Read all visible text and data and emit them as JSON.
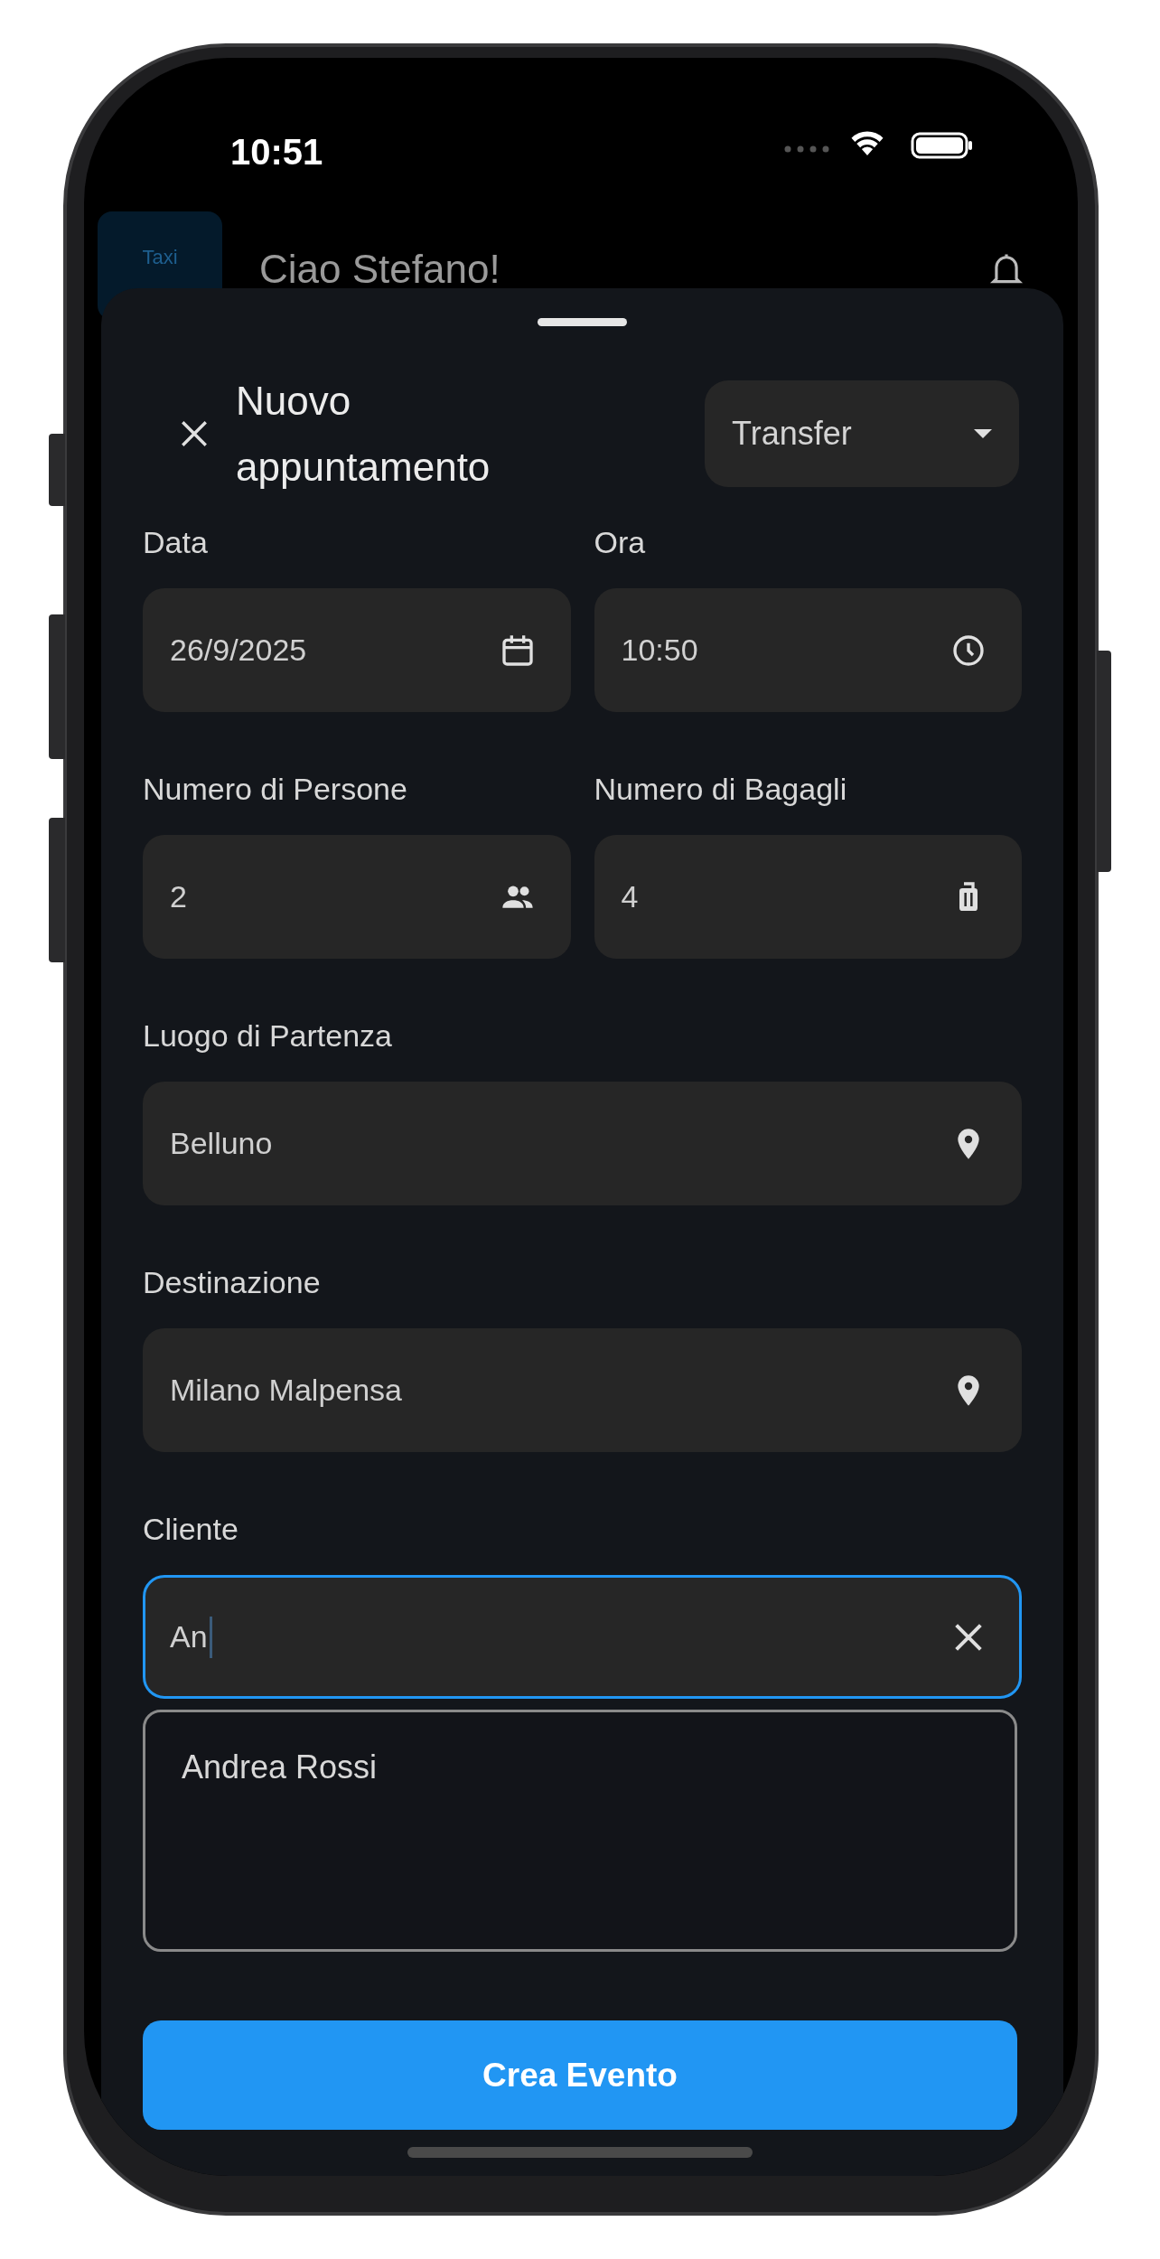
{
  "status_bar": {
    "time": "10:51"
  },
  "background": {
    "logo_text": "Taxi",
    "greeting": "Ciao Stefano!"
  },
  "sheet": {
    "title": "Nuovo appuntamento",
    "type_dropdown": {
      "value": "Transfer"
    },
    "rows": [
      [
        {
          "label": "Data",
          "value": "26/9/2025",
          "kind": "calendar",
          "focused": false
        },
        {
          "label": "Ora",
          "value": "10:50",
          "kind": "clock",
          "focused": false
        }
      ],
      [
        {
          "label": "Numero di Persone",
          "value": "2",
          "kind": "people",
          "focused": false
        },
        {
          "label": "Numero di Bagagli",
          "value": "4",
          "kind": "luggage",
          "focused": false
        }
      ],
      [
        {
          "label": "Luogo di Partenza",
          "value": "Belluno",
          "kind": "pin",
          "focused": false
        }
      ],
      [
        {
          "label": "Destinazione",
          "value": "Milano Malpensa",
          "kind": "pin",
          "focused": false
        }
      ],
      [
        {
          "label": "Cliente",
          "value": "An",
          "kind": "clear",
          "focused": true
        }
      ]
    ],
    "suggestions": [
      "Andrea Rossi"
    ],
    "submit_button": "Crea Evento"
  }
}
